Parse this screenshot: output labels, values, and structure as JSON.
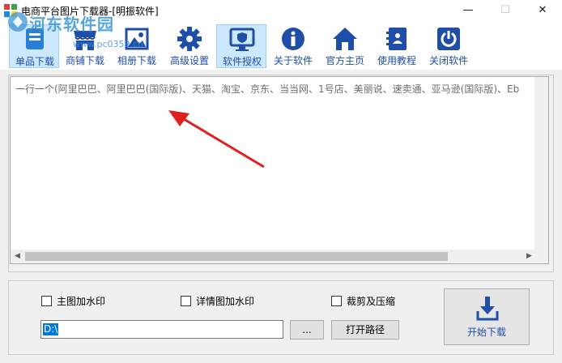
{
  "window": {
    "title": "电商平台图片下载器-[明振软件]",
    "minimize_glyph": "—",
    "maximize_glyph": "☐",
    "close_glyph": "✕"
  },
  "watermark": {
    "text": "河东软件园",
    "url": "www.pc0359.cn"
  },
  "toolbar": {
    "items": [
      {
        "label": "单品下载",
        "icon": "blue-file-icon",
        "active": true
      },
      {
        "label": "商铺下载",
        "icon": "shop-icon",
        "active": false
      },
      {
        "label": "相册下载",
        "icon": "album-icon",
        "active": false
      },
      {
        "label": "高级设置",
        "icon": "gear-icon",
        "active": false
      },
      {
        "label": "软件授权",
        "icon": "shield-monitor-icon",
        "active": false
      },
      {
        "label": "关于软件",
        "icon": "info-icon",
        "active": false
      },
      {
        "label": "官方主页",
        "icon": "home-icon",
        "active": false
      },
      {
        "label": "使用教程",
        "icon": "book-icon",
        "active": false
      },
      {
        "label": "关闭软件",
        "icon": "power-icon",
        "active": false
      }
    ]
  },
  "url_input": {
    "placeholder": "一行一个(阿里巴巴、阿里巴巴(国际版)、天猫、淘宝、京东、当当网、1号店、美丽说、速卖通、亚马逊(国际版)、Eb"
  },
  "options": {
    "main_watermark": "主图加水印",
    "detail_watermark": "详情图加水印",
    "crop_compress": "裁剪及压缩"
  },
  "path": {
    "value": "D:\\",
    "browse_label": "...",
    "open_label": "打开路径"
  },
  "start": {
    "label": "开始下载"
  },
  "colors": {
    "icon_blue": "#1f4ea6",
    "active_bg": "#cce8ff",
    "arrow_red": "#e02020"
  }
}
